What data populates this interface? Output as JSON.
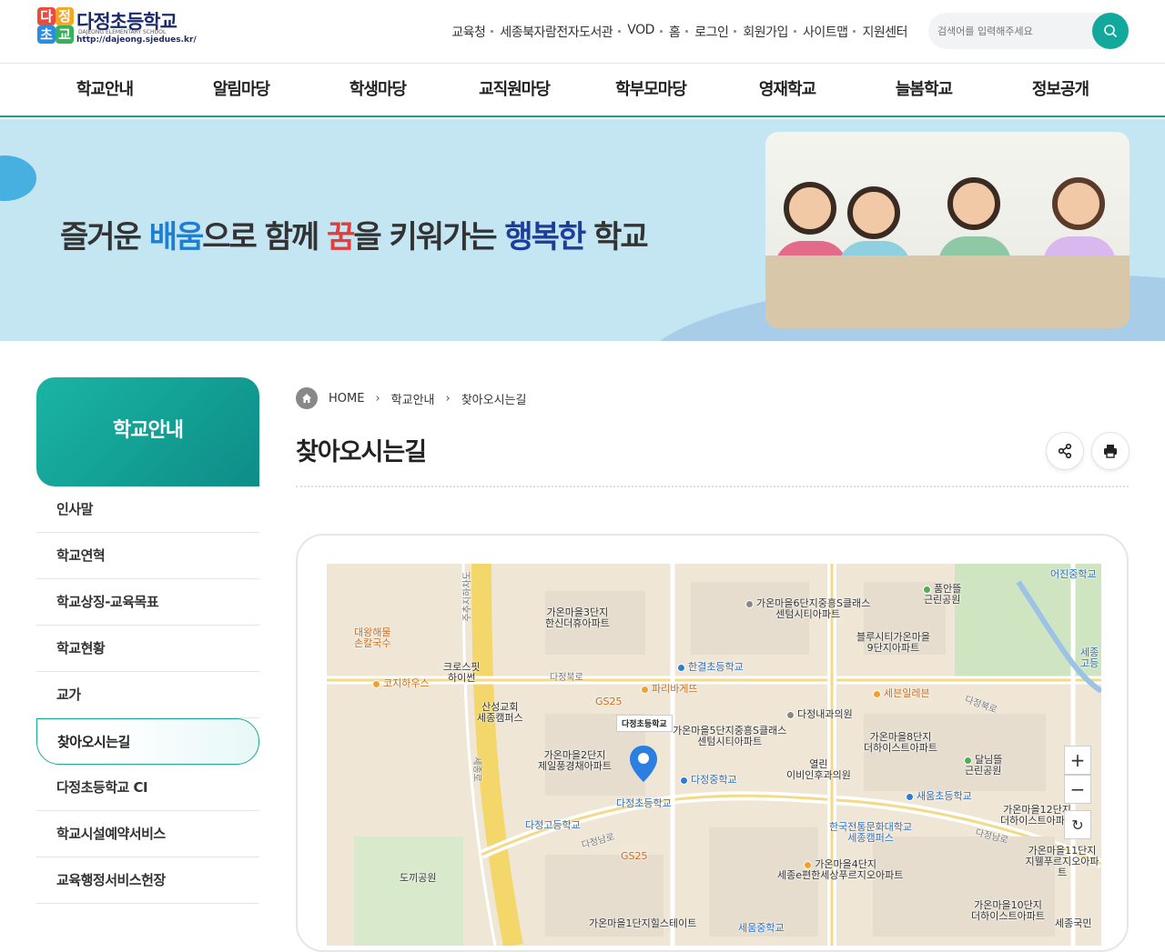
{
  "header": {
    "logo_name": "다정초등학교",
    "logo_sub": "DAJEONG ELEMENTARY SCHOOL",
    "logo_url": "http://dajeong.sjedues.kr/",
    "logo_chars": [
      "다",
      "정",
      "초",
      "교"
    ],
    "util_links": [
      "교육청",
      "세종북자람전자도서관",
      "VOD",
      "홈",
      "로그인",
      "회원가입",
      "사이트맵",
      "지원센터"
    ],
    "search_placeholder": "검색어를 입력해주세요"
  },
  "gnb": [
    "학교안내",
    "알림마당",
    "학생마당",
    "교직원마당",
    "학부모마당",
    "영재학교",
    "늘봄학교",
    "정보공개"
  ],
  "visual": {
    "slogan_1": "즐거운 ",
    "slogan_2": "배움",
    "slogan_3": "으로 함께 ",
    "slogan_4": "꿈",
    "slogan_5": "을 키워가는 ",
    "slogan_6": "행복한",
    "slogan_7": " 학교"
  },
  "sidebar": {
    "title": "학교안내",
    "items": [
      "인사말",
      "학교연혁",
      "학교상징-교육목표",
      "학교현황",
      "교가",
      "찾아오시는길",
      "다정초등학교 CI",
      "학교시설예약서비스",
      "교육행정서비스헌장"
    ],
    "active_index": 5
  },
  "breadcrumb": [
    "HOME",
    "학교안내",
    "찾아오시는길"
  ],
  "page_title": "찾아오시는길",
  "map": {
    "labels": [
      {
        "text": "가온마을3단지\n한신더휴아파트",
        "icon": "none"
      },
      {
        "text": "가온마을6단지중흥S클래스\n센텀시티아파트",
        "icon": "gray"
      },
      {
        "text": "품안뜰\n근린공원",
        "icon": "green"
      },
      {
        "text": "어진중학교",
        "icon": "none"
      },
      {
        "text": "대왕해물\n손칼국수",
        "icon": "none"
      },
      {
        "text": "블루시티가온마을\n9단지아파트",
        "icon": "none"
      },
      {
        "text": "크로스핏\n하이썬",
        "icon": "none"
      },
      {
        "text": "한결초등학교",
        "icon": "blue"
      },
      {
        "text": "코지하우스",
        "icon": "orange"
      },
      {
        "text": "파리바게뜨",
        "icon": "orange"
      },
      {
        "text": "세븐일레븐",
        "icon": "orange"
      },
      {
        "text": "GS25",
        "icon": "orange"
      },
      {
        "text": "산성교회\n세종캠퍼스",
        "icon": "gray"
      },
      {
        "text": "다정내과의원",
        "icon": "gray"
      },
      {
        "text": "가온마을5단지중흥S클래스\n센텀시티아파트",
        "icon": "orange"
      },
      {
        "text": "가온마을8단지\n더하이스트아파트",
        "icon": "none"
      },
      {
        "text": "가온마을2단지\n제일풍경채아파트",
        "icon": "none"
      },
      {
        "text": "다정중학교",
        "icon": "blue"
      },
      {
        "text": "열린\n이비인후과의원",
        "icon": "gray"
      },
      {
        "text": "달님뜰\n근린공원",
        "icon": "green"
      },
      {
        "text": "다정초등학교",
        "icon": "blue"
      },
      {
        "text": "새움초등학교",
        "icon": "blue"
      },
      {
        "text": "가온마을12단지\n더하이스트아파트",
        "icon": "none"
      },
      {
        "text": "다정고등학교",
        "icon": "blue"
      },
      {
        "text": "한국전통문화대학교\n세종캠퍼스",
        "icon": "blue"
      },
      {
        "text": "GS25",
        "icon": "orange"
      },
      {
        "text": "가온마을11단지\n지웰푸르지오아파트",
        "icon": "none"
      },
      {
        "text": "도끼공원",
        "icon": "green"
      },
      {
        "text": "가온마을4단지\n세종e편한세상푸르지오아파트",
        "icon": "orange"
      },
      {
        "text": "가온마을10단지\n더하이스트아파트",
        "icon": "orange"
      },
      {
        "text": "가온마을1단지힐스테이트",
        "icon": "orange"
      },
      {
        "text": "세움중학교",
        "icon": "blue"
      },
      {
        "text": "세종국민",
        "icon": "gray"
      },
      {
        "text": "세종\n고등",
        "icon": "blue"
      }
    ],
    "road_labels": [
      "다정북로",
      "다정북로",
      "다정남로",
      "다정남로",
      "세종로",
      "주추지하차도"
    ],
    "marker_label": "다정초등학교",
    "controls": [
      "+",
      "−",
      "↻"
    ]
  },
  "colors": {
    "accent": "#12a89c",
    "nav_accent": "#14a394",
    "visual_bg": "#c3e6f2"
  }
}
